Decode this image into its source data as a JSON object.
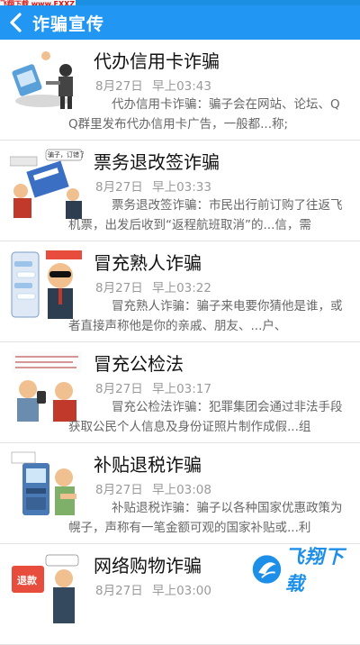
{
  "watermark": {
    "url": "飞翔下载 www.FXXZ.com",
    "brand": "飞翔下载"
  },
  "header": {
    "title": "诈骗宣传"
  },
  "articles": [
    {
      "title": "代办信用卡诈骗",
      "date": "8月27日",
      "time": "早上03:43",
      "summary": "代办信用卡诈骗：骗子会在网站、论坛、QQ群里发布代办信用卡广告，一般都...称;"
    },
    {
      "title": "票务退改签诈骗",
      "date": "8月27日",
      "time": "早上03:33",
      "summary": "票务退改签诈骗：市民出行前订购了往返飞机票，出发后收到“返程航班取消”的...信，需"
    },
    {
      "title": "冒充熟人诈骗",
      "date": "8月27日",
      "time": "早上03:22",
      "summary": "冒充熟人诈骗：骗子来电要你猜他是谁，或者直接声称他是你的亲戚、朋友、...户、"
    },
    {
      "title": "冒充公检法",
      "date": "8月27日",
      "time": "早上03:17",
      "summary": "冒充公检法诈骗：犯罪集团会通过非法手段获取公民个人信息及身份证照片制作成假...组"
    },
    {
      "title": "补贴退税诈骗",
      "date": "8月27日",
      "time": "早上03:08",
      "summary": "补贴退税诈骗：骗子以各种国家优惠政策为幌子，声称有一笔金额可观的国家补贴或...利"
    },
    {
      "title": "网络购物诈骗",
      "date": "8月27日",
      "time": "早上03:00",
      "summary": ""
    }
  ],
  "thumbs": [
    {
      "caption": ""
    },
    {
      "caption": "骗子，订错了"
    },
    {
      "caption": ""
    },
    {
      "caption": ""
    },
    {
      "caption": ""
    },
    {
      "caption": "退款"
    }
  ]
}
